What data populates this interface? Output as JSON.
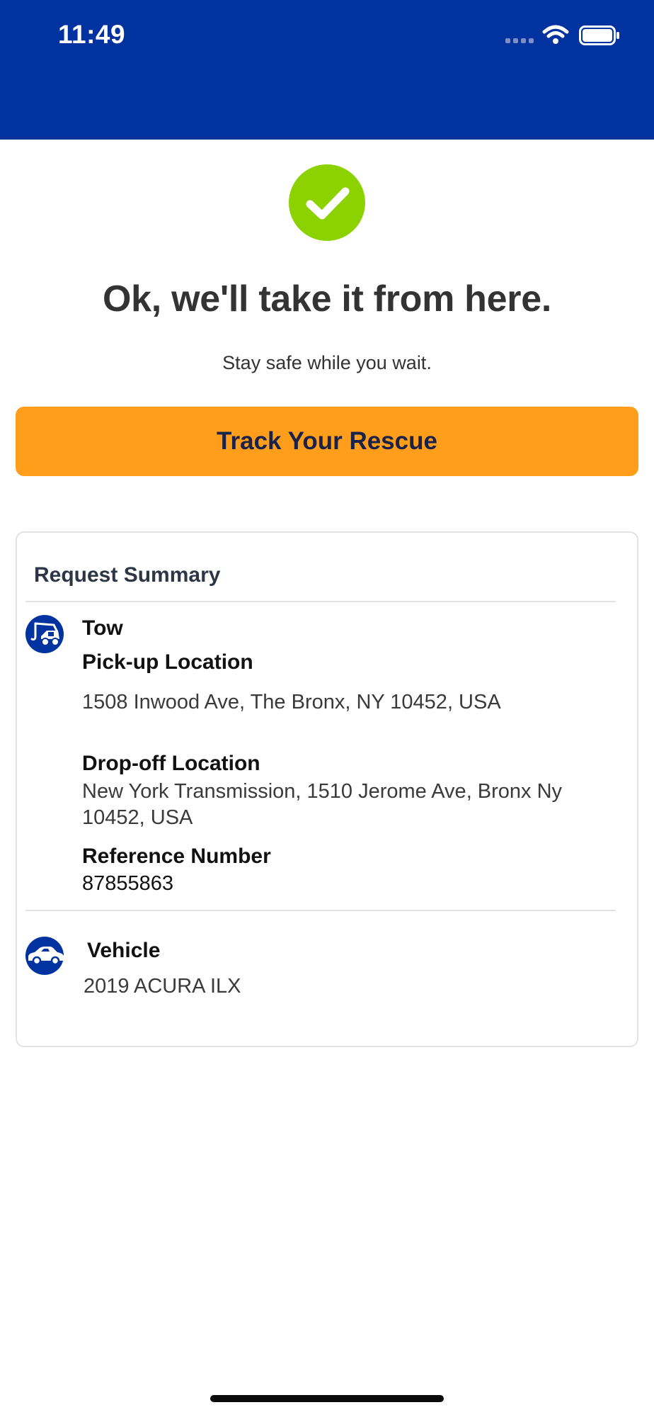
{
  "status_bar": {
    "time": "11:49",
    "background": "#0033a0",
    "icons": [
      "signal-dots-icon",
      "wifi-icon",
      "battery-icon"
    ]
  },
  "confirmation": {
    "icon": "check-icon",
    "icon_color": "#8cd100",
    "headline": "Ok, we'll take it from here.",
    "subline": "Stay safe while you wait."
  },
  "actions": {
    "track_label": "Track Your Rescue",
    "track_color": "#ff9e1b"
  },
  "summary": {
    "title": "Request Summary",
    "service": {
      "icon": "tow-truck-icon",
      "type": "Tow",
      "pickup_label": "Pick-up Location",
      "pickup_value": "1508 Inwood Ave, The Bronx, NY 10452, USA",
      "dropoff_label": "Drop-off Location",
      "dropoff_value_line1": "New York Transmission, 1510 Jerome Ave, Bronx Ny",
      "dropoff_value_line2": "10452, USA",
      "reference_label": "Reference Number",
      "reference_value": "87855863"
    },
    "vehicle": {
      "icon": "car-icon",
      "label": "Vehicle",
      "value": "2019 ACURA ILX"
    }
  }
}
